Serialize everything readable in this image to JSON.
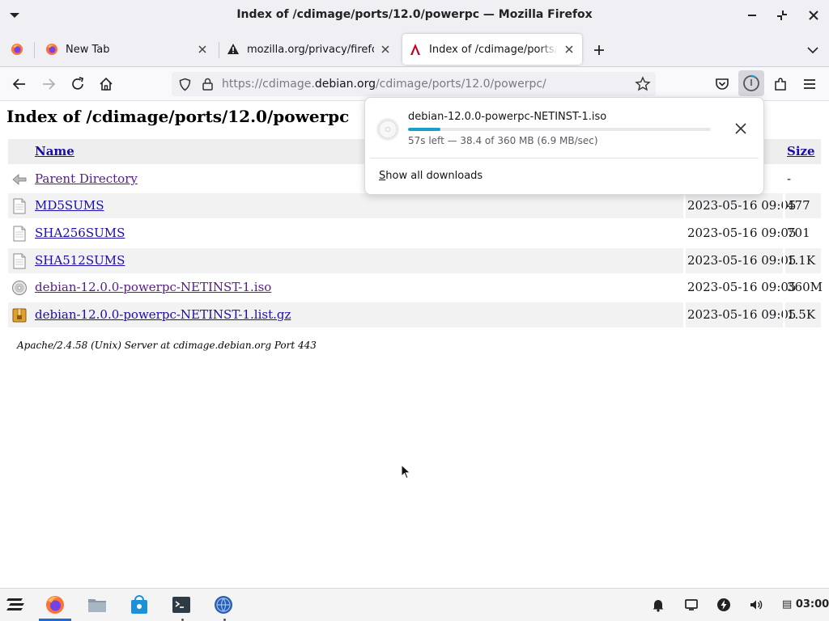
{
  "window": {
    "title": "Index of /cdimage/ports/12.0/powerpc — Mozilla Firefox"
  },
  "tabs": [
    {
      "label": "New Tab",
      "favicon": "firefox-icon"
    },
    {
      "label": "mozilla.org/privacy/firefox/",
      "favicon": "warning-icon"
    },
    {
      "label": "Index of /cdimage/ports/12.0/powerpc",
      "favicon": "debian-icon",
      "active": true
    }
  ],
  "navbar": {
    "url_prefix": "https://cdimage.",
    "url_host": "debian.org",
    "url_path": "/cdimage/ports/12.0/powerpc/"
  },
  "page": {
    "heading": "Index of /cdimage/ports/12.0/powerpc",
    "columns": {
      "name": "Name",
      "size": "Size"
    },
    "rows": [
      {
        "name": "Parent Directory",
        "date": "",
        "size": "-",
        "icon": "back-icon",
        "visited": true
      },
      {
        "name": "MD5SUMS",
        "date": "2023-05-16 09:05",
        "size": "477",
        "icon": "text-file-icon",
        "visited": false
      },
      {
        "name": "SHA256SUMS",
        "date": "2023-05-16 09:05",
        "size": "701",
        "icon": "text-file-icon",
        "visited": false
      },
      {
        "name": "SHA512SUMS",
        "date": "2023-05-16 09:05",
        "size": "1.1K",
        "icon": "text-file-icon",
        "visited": false
      },
      {
        "name": "debian-12.0.0-powerpc-NETINST-1.iso",
        "date": "2023-05-16 09:05",
        "size": "360M",
        "icon": "disc-icon",
        "visited": true
      },
      {
        "name": "debian-12.0.0-powerpc-NETINST-1.list.gz",
        "date": "2023-05-16 09:05",
        "size": "1.5K",
        "icon": "archive-icon",
        "visited": false
      }
    ],
    "footer": "Apache/2.4.58 (Unix) Server at cdimage.debian.org Port 443"
  },
  "downloads": {
    "filename": "debian-12.0.0-powerpc-NETINST-1.iso",
    "status": "57s left — 38.4 of 360 MB (6.9 MB/sec)",
    "progress_fraction": 0.107,
    "show_all_accel": "S",
    "show_all_rest": "how all downloads"
  },
  "taskbar": {
    "clock": "03:00",
    "apps": [
      "zorin-menu-icon",
      "firefox-icon",
      "files-icon",
      "software-store-icon",
      "terminal-icon",
      "network-globe-icon"
    ]
  },
  "colors": {
    "accent": "#1a9fc9",
    "link": "#1a0dab",
    "visited": "#551a8b"
  }
}
